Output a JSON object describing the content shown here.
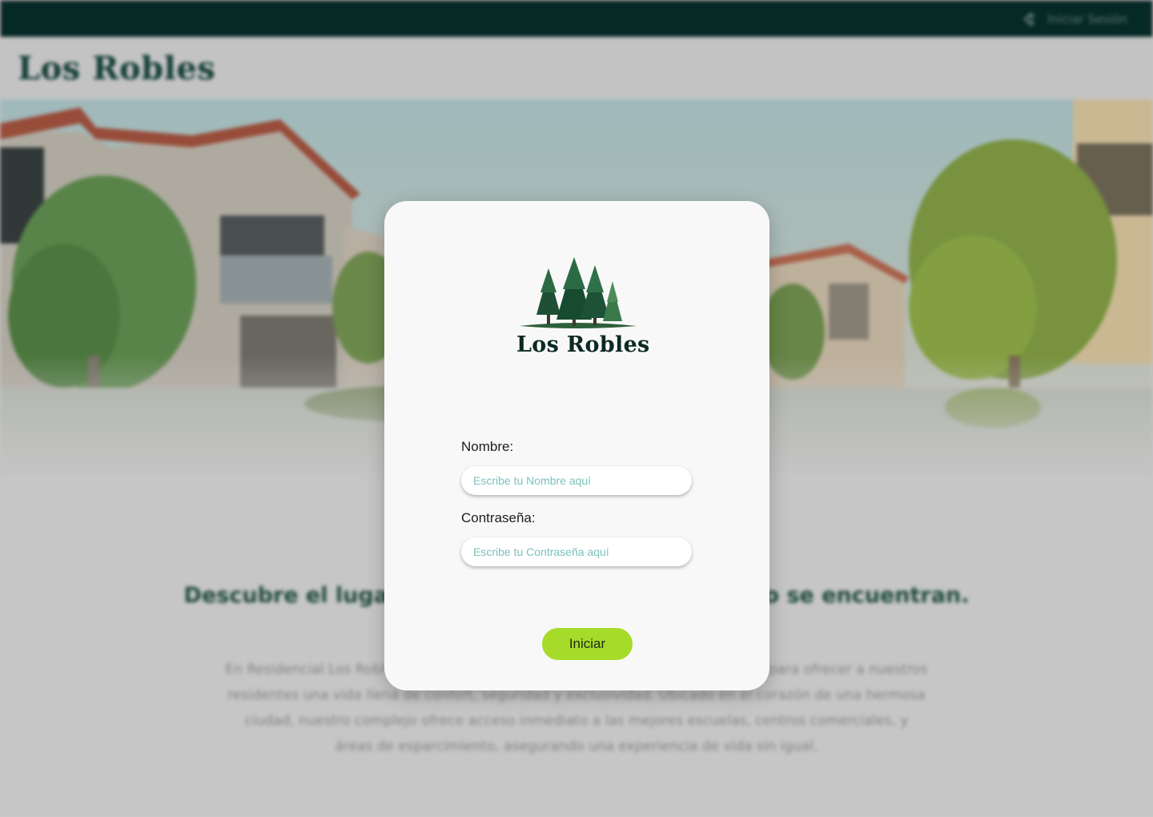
{
  "header": {
    "login_link": "Iniciar Sesión",
    "brand": "Los Robles"
  },
  "content": {
    "headline": "Descubre el lugar donde la comodidad y el estilo se encuentran.",
    "body": "En Residencial Los Robles hemos creado un entorno cuidadosamente diseñado para ofrecer a nuestros residentes una vida llena de confort, seguridad y exclusividad. Ubicado en el corazón de una hermosa ciudad, nuestro complejo ofrece acceso inmediato a las mejores escuelas, centros comerciales, y áreas de esparcimiento, asegurando una experiencia de vida sin igual."
  },
  "modal": {
    "logo_text": "Los Robles",
    "name_label": "Nombre:",
    "name_placeholder": "Escribe tu Nombre aquí",
    "password_label": "Contraseña:",
    "password_placeholder": "Escribe tu Contraseña aquí",
    "submit_label": "Iniciar"
  },
  "colors": {
    "topbar": "#002823",
    "accent_button": "#a6db2a",
    "brand_green": "#0f3d33",
    "placeholder": "#7cc2bb"
  },
  "icons": {
    "login": "login-arrow-icon",
    "logo": "pine-trees-icon"
  }
}
